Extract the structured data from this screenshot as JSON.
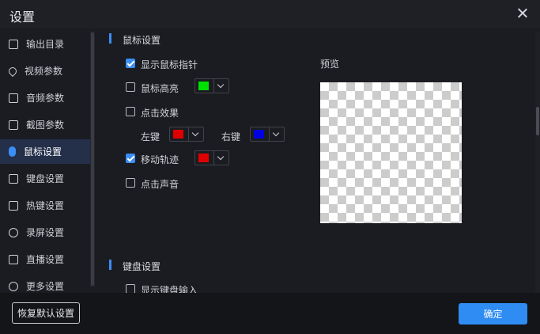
{
  "window": {
    "title": "设置"
  },
  "sidebar": {
    "items": [
      {
        "label": "输出目录",
        "icon": "folder-icon"
      },
      {
        "label": "视频参数",
        "icon": "location-icon"
      },
      {
        "label": "音频参数",
        "icon": "audio-icon"
      },
      {
        "label": "截图参数",
        "icon": "screenshot-icon"
      },
      {
        "label": "鼠标设置",
        "icon": "mouse-icon",
        "active": true
      },
      {
        "label": "键盘设置",
        "icon": "keyboard-icon"
      },
      {
        "label": "热键设置",
        "icon": "hotkey-icon"
      },
      {
        "label": "录屏设置",
        "icon": "record-icon"
      },
      {
        "label": "直播设置",
        "icon": "live-icon"
      },
      {
        "label": "更多设置",
        "icon": "more-settings-icon"
      }
    ]
  },
  "mouse_section": {
    "title": "鼠标设置",
    "show_cursor": {
      "label": "显示鼠标指针",
      "checked": true
    },
    "highlight": {
      "label": "鼠标高亮",
      "checked": false,
      "color": "#00e000"
    },
    "click_effect": {
      "label": "点击效果",
      "checked": false
    },
    "left_key": {
      "label": "左键",
      "color": "#e00000"
    },
    "right_key": {
      "label": "右键",
      "color": "#0000e0"
    },
    "track": {
      "label": "移动轨迹",
      "checked": true,
      "color": "#e00000"
    },
    "click_sound": {
      "label": "点击声音",
      "checked": false
    },
    "preview_label": "预览"
  },
  "keyboard_section": {
    "title": "键盘设置",
    "show_input": {
      "label": "显示键盘输入",
      "checked": false
    }
  },
  "footer": {
    "reset_label": "恢复默认设置",
    "ok_label": "确定"
  },
  "colors": {
    "accent": "#2f8cf3"
  }
}
